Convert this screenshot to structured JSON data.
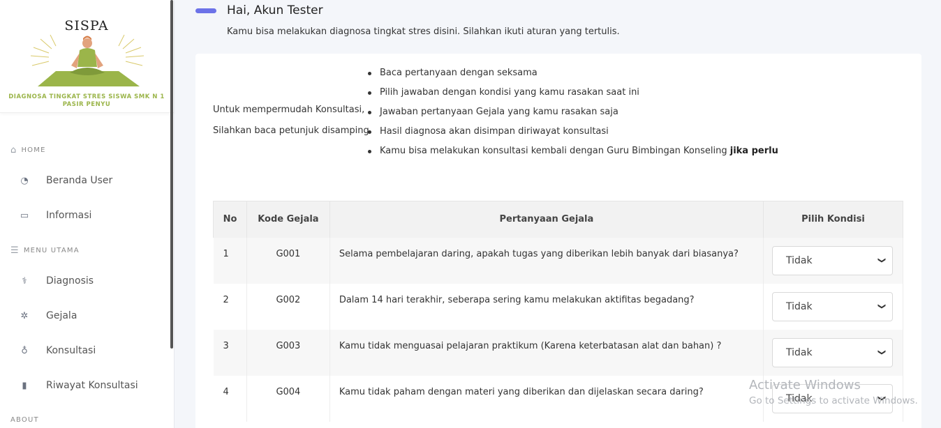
{
  "brand": {
    "title": "SISPA",
    "subtitle": "DIAGNOSA TINGKAT STRES SISWA SMK N 1 PASIR PENYU"
  },
  "sidebar": {
    "sections": [
      {
        "label": "HOME",
        "icon": "home-icon"
      },
      {
        "label": "MENU UTAMA",
        "icon": "list-icon"
      },
      {
        "label": "ABOUT",
        "icon": ""
      }
    ],
    "items": [
      {
        "label": "Beranda User",
        "icon": "dashboard-icon"
      },
      {
        "label": "Informasi",
        "icon": "inbox-icon"
      },
      {
        "label": "Diagnosis",
        "icon": "diagnosis-icon"
      },
      {
        "label": "Gejala",
        "icon": "virus-icon"
      },
      {
        "label": "Konsultasi",
        "icon": "stethoscope-icon"
      },
      {
        "label": "Riwayat Konsultasi",
        "icon": "clipboard-icon"
      }
    ]
  },
  "header": {
    "greeting": "Hai, Akun Tester",
    "subtitle": "Kamu bisa melakukan diagnosa tingkat stres disini. Silahkan ikuti aturan yang tertulis."
  },
  "intro": {
    "line1": "Untuk mempermudah Konsultasi,",
    "line2": "Silahkan baca petunjuk disamping."
  },
  "rules": [
    "Baca pertanyaan dengan seksama",
    "Pilih jawaban dengan kondisi yang kamu rasakan saat ini",
    "Jawaban pertanyaan Gejala yang kamu rasakan saja",
    "Hasil diagnosa akan disimpan diriwayat konsultasi"
  ],
  "rule_last": {
    "text": "Kamu bisa melakukan konsultasi kembali dengan Guru Bimbingan Konseling ",
    "bold": "jika perlu"
  },
  "table": {
    "headers": [
      "No",
      "Kode Gejala",
      "Pertanyaan Gejala",
      "Pilih Kondisi"
    ],
    "rows": [
      {
        "no": "1",
        "kode": "G001",
        "tanya": "Selama pembelajaran daring, apakah tugas yang diberikan lebih banyak dari biasanya?",
        "pilih": "Tidak"
      },
      {
        "no": "2",
        "kode": "G002",
        "tanya": "Dalam 14 hari terakhir, seberapa sering kamu melakukan aktifitas begadang?",
        "pilih": "Tidak"
      },
      {
        "no": "3",
        "kode": "G003",
        "tanya": "Kamu tidak menguasai pelajaran praktikum (Karena keterbatasan alat dan bahan) ?",
        "pilih": "Tidak"
      },
      {
        "no": "4",
        "kode": "G004",
        "tanya": "Kamu tidak paham dengan materi yang diberikan dan dijelaskan secara daring?",
        "pilih": "Tidak"
      }
    ]
  },
  "watermark": {
    "line1": "Activate Windows",
    "line2": "Go to Settings to activate Windows."
  },
  "colors": {
    "accent": "#6c72e8",
    "brand_green": "#9bb54a"
  }
}
